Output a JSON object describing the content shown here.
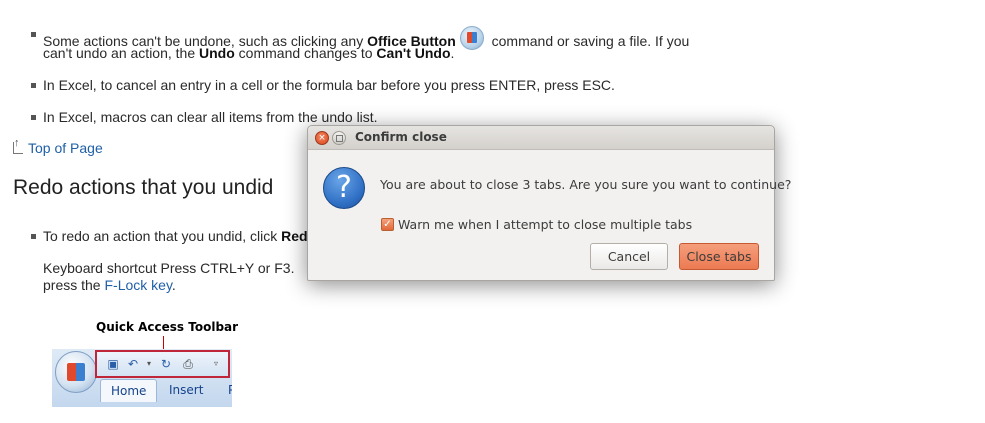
{
  "bullets": {
    "b1_part1": "Some actions can't be undone, such as clicking any ",
    "b1_bold1": "Office Button",
    "b1_part2": " command or saving a file. If you",
    "b1_line2_part1": "can't undo an action, the ",
    "b1_bold2": "Undo",
    "b1_line2_part2": " command changes to ",
    "b1_bold3": "Can't Undo",
    "b1_line2_end": ".",
    "b2": "In Excel, to cancel an entry in a cell or the formula bar before you press ENTER, press ESC.",
    "b3": "In Excel, macros can clear all items from the undo list."
  },
  "top_link": "Top of Page",
  "section_title": "Redo actions that you undid",
  "redo": {
    "bullet_text": "To redo an action that you undid, click ",
    "bullet_bold": "Red",
    "shortcut_line": "Keyboard shortcut  Press CTRL+Y or F3.",
    "press_the": "press the ",
    "flock_link": "F-Lock key",
    "period": "."
  },
  "figure": {
    "label": "Quick Access Toolbar",
    "tabs": [
      "Home",
      "Insert",
      "P"
    ]
  },
  "dialog": {
    "title": "Confirm close",
    "message": "You are about to close 3 tabs. Are you sure you want to continue?",
    "checkbox_label": "Warn me when I attempt to close multiple tabs",
    "checkbox_checked": true,
    "cancel_label": "Cancel",
    "close_label": "Close tabs",
    "accent_color": "#ec7a52"
  }
}
